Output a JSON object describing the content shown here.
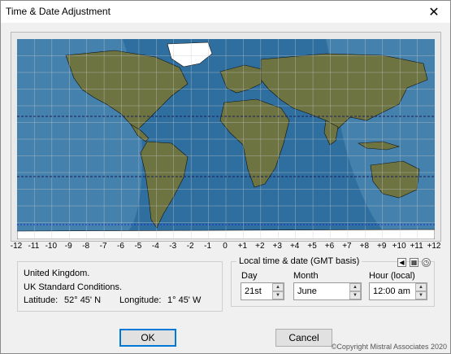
{
  "window": {
    "title": "Time & Date Adjustment",
    "close_glyph": "✕"
  },
  "map": {
    "ocean_color": "#2e6fa0",
    "night_color": "#5a8fb8",
    "grid_color": "#c8c8c8",
    "tropic_color": "#1a1a5a",
    "land_color": "#6d7442",
    "ice_color": "#ffffff"
  },
  "timezone_ticks": [
    "-12",
    "-11",
    "-10",
    "-9",
    "-8",
    "-7",
    "-6",
    "-5",
    "-4",
    "-3",
    "-2",
    "-1",
    "0",
    "+1",
    "+2",
    "+3",
    "+4",
    "+5",
    "+6",
    "+7",
    "+8",
    "+9",
    "+10",
    "+11",
    "+12"
  ],
  "info": {
    "country": "United Kingdom.",
    "conditions": "UK Standard Conditions.",
    "latitude_label": "Latitude:",
    "latitude_value": "52° 45' N",
    "longitude_label": "Longitude:",
    "longitude_value": "1° 45' W"
  },
  "local_time": {
    "group_label": "Local time & date  (GMT basis)",
    "day_label": "Day",
    "day_value": "21st",
    "month_label": "Month",
    "month_value": "June",
    "hour_label": "Hour (local)",
    "hour_value": "12:00 am"
  },
  "buttons": {
    "ok": "OK",
    "cancel": "Cancel"
  },
  "copyright": "©Copyright Mistral Associates 2020"
}
